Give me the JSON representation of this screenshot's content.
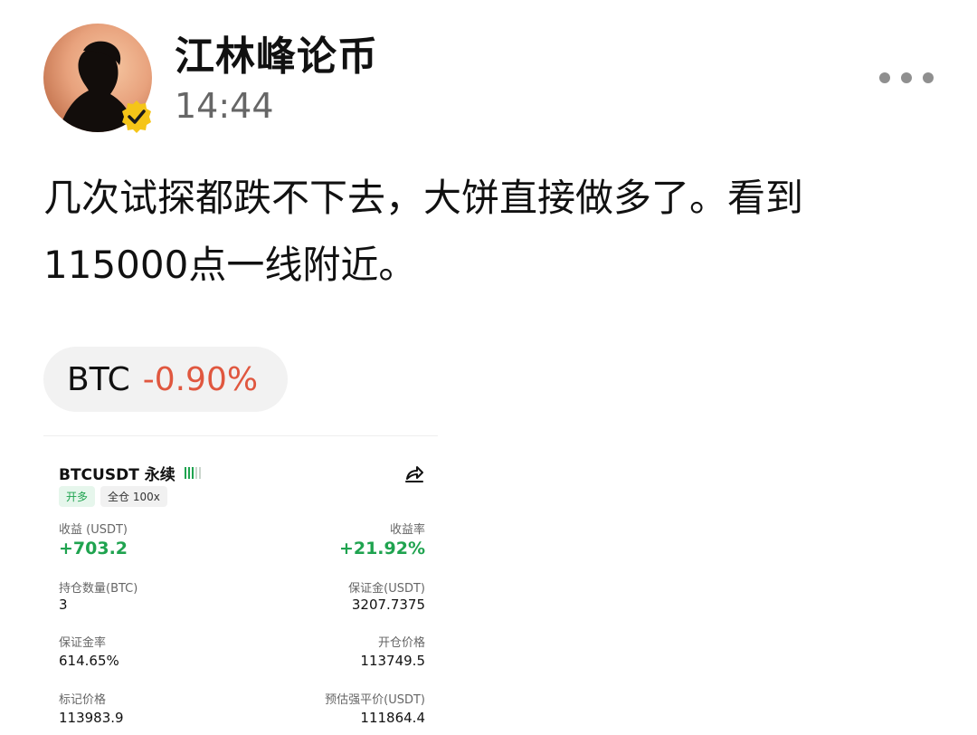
{
  "post": {
    "author": "江林峰论币",
    "time": "14:44",
    "text": "几次试探都跌不下去，大饼直接做多了。看到115000点一线附近。"
  },
  "icons": {
    "more": "more-dots-icon",
    "verified": "verified-badge-icon",
    "share": "share-icon"
  },
  "ticker": {
    "symbol": "BTC",
    "change": "-0.90%",
    "change_color": "#e0573f"
  },
  "position_card": {
    "pair": "BTCUSDT 永续",
    "tags": {
      "side": "开多",
      "margin_mode": "全仓 100x"
    },
    "pnl_label": "收益 (USDT)",
    "pnl_value": "+703.2",
    "roi_label": "收益率",
    "roi_value": "+21.92%",
    "size_label": "持仓数量(BTC)",
    "size_value": "3",
    "margin_label": "保证金(USDT)",
    "margin_value": "3207.7375",
    "margin_ratio_label": "保证金率",
    "margin_ratio_value": "614.65%",
    "entry_label": "开仓价格",
    "entry_value": "113749.5",
    "mark_label": "标记价格",
    "mark_value": "113983.9",
    "liq_label": "预估强平价(USDT)",
    "liq_value": "111864.4",
    "accent_green": "#1fa34f"
  }
}
